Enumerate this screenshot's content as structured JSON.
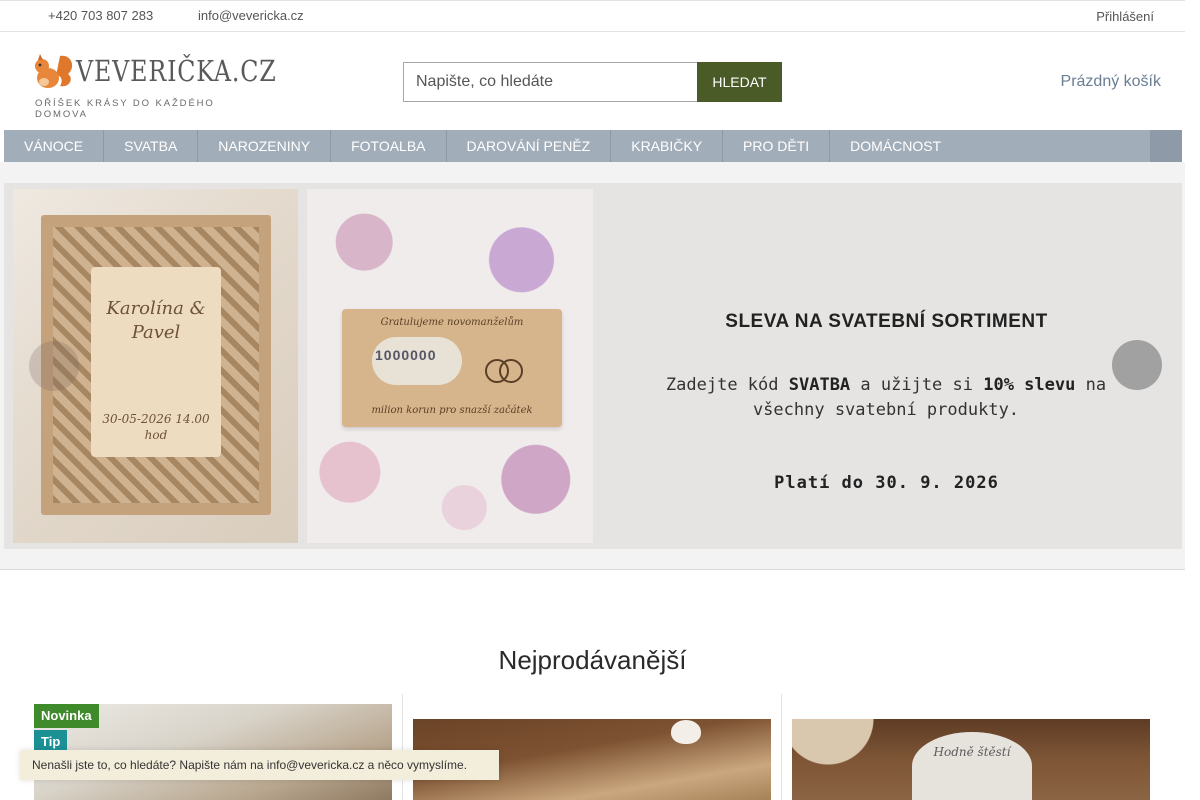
{
  "topbar": {
    "phone": "+420 703 807 283",
    "email": "info@vevericka.cz",
    "login": "Přihlášení"
  },
  "header": {
    "logo_text": "VEVERIČKA.CZ",
    "tagline": "OŘÍŠEK KRÁSY DO KAŽDÉHO DOMOVA",
    "search_placeholder": "Napište, co hledáte",
    "search_button": "HLEDAT",
    "cart": "Prázdný košík"
  },
  "nav": {
    "items": [
      "VÁNOCE",
      "SVATBA",
      "NAROZENINY",
      "FOTOALBA",
      "DAROVÁNÍ PENĚZ",
      "KRABIČKY",
      "PRO DĚTI",
      "DOMÁCNOST"
    ]
  },
  "banner": {
    "photo1_names": "Karolína & Pavel",
    "photo1_date": "30-05-2026 14.00 hod",
    "photo2_top": "Gratulujeme novomanželům",
    "photo2_note": "1000000",
    "photo2_bottom": "milion korun pro snazší začátek",
    "title": "SLEVA NA SVATEBNÍ SORTIMENT",
    "text_pre": "Zadejte kód ",
    "code": "SVATBA",
    "text_mid": " a užijte si ",
    "discount": "10% slevu",
    "text_post": " na všechny svatební produkty.",
    "valid": "Platí do 30. 9. 2026"
  },
  "bestsellers": {
    "title": "Nejprodávanější"
  },
  "products": [
    {
      "badges": [
        "Novinka",
        "Tip"
      ]
    },
    {
      "badges": []
    },
    {
      "badges": [],
      "napkin_text": "Hodně štěstí"
    }
  ],
  "badges": {
    "new": "Novinka",
    "tip": "Tip"
  },
  "toast": "Nenašli jste to, co hledáte? Napište nám na info@vevericka.cz a něco vymyslíme.",
  "colors": {
    "nav_bg": "#a2adba",
    "search_button": "#4a5b28",
    "badge_new": "#3f8a2b",
    "badge_tip": "#1b9196",
    "cart_link": "#6a7d94"
  },
  "icons": {
    "logo": "squirrel-logo-icon",
    "prev": "slider-prev-icon",
    "next": "slider-next-icon"
  }
}
